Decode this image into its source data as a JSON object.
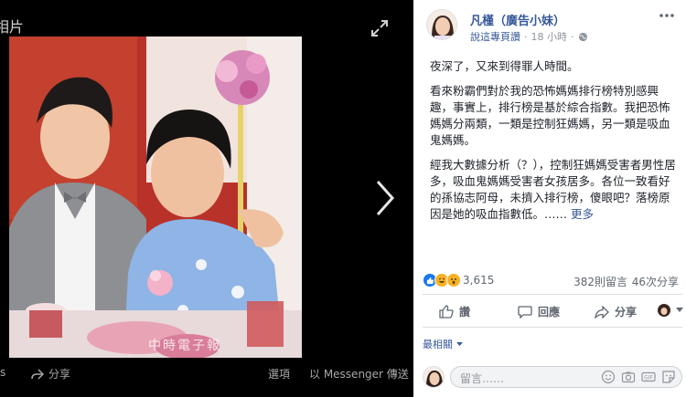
{
  "viewer": {
    "title": "相片",
    "actions": {
      "share": "分享",
      "options": "選項",
      "send": "以 Messenger 傳送",
      "left_fragment": "s"
    },
    "photo_watermark": "中時電子報"
  },
  "post": {
    "author": "凡槿（廣告小妹）",
    "meta_link": "說這專頁讚",
    "time": "18 小時",
    "paragraphs": [
      "夜深了，又來到得罪人時間。",
      "看來粉霸們對於我的恐怖媽媽排行榜特別感興趣，事實上，排行榜是基於綜合指數。我把恐怖媽媽分兩類，一類是控制狂媽媽，另一類是吸血鬼媽媽。",
      "經我大數據分析（？），控制狂媽媽受害者男性居多，吸血鬼媽媽受害者女孩居多。各位一致看好的孫協志阿母，未擠入排行榜，傻眼吧？落榜原因是她的吸血指數低。……"
    ],
    "more_label": "更多",
    "reaction_count": "3,615",
    "comment_count": "382則留言",
    "share_count": "46次分享",
    "actions": {
      "like": "讚",
      "comment": "回應",
      "share": "分享"
    },
    "sort_label": "最相關",
    "comment_placeholder": "留言……"
  },
  "colors": {
    "link_blue": "#365899",
    "like_blue": "#1877f2",
    "haha_yellow": "#f7b125",
    "text": "#1d2129",
    "muted": "#606770"
  }
}
